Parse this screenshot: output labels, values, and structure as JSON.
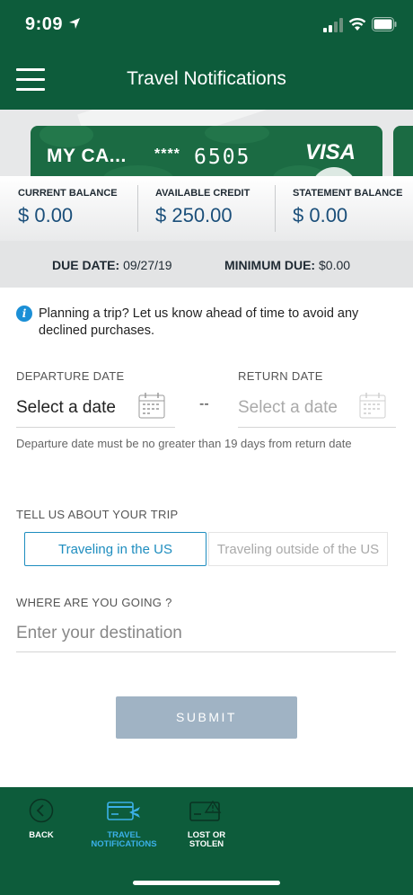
{
  "status_bar": {
    "time": "9:09"
  },
  "nav": {
    "title": "Travel Notifications",
    "menu_icon": "hamburger-menu-icon"
  },
  "card": {
    "name": "MY CA...",
    "masked": "****",
    "last_digits": "6505",
    "network": "VISA",
    "color": "#1b6b43"
  },
  "balances": [
    {
      "label": "CURRENT BALANCE",
      "value": "$ 0.00"
    },
    {
      "label": "AVAILABLE CREDIT",
      "value": "$ 250.00"
    },
    {
      "label": "STATEMENT BALANCE",
      "value": "$ 0.00"
    }
  ],
  "due": {
    "due_label": "DUE DATE:",
    "due_value": "09/27/19",
    "min_label": "MINIMUM DUE:",
    "min_value": "$0.00"
  },
  "info": {
    "text": "Planning a trip? Let us know ahead of time to avoid any declined purchases."
  },
  "dates": {
    "departure_label": "DEPARTURE DATE",
    "departure_value": "Select a date",
    "return_label": "RETURN DATE",
    "return_value": "Select a date",
    "separator": "--",
    "hint": "Departure date must be no greater than 19 days from return date"
  },
  "trip": {
    "label": "TELL US ABOUT YOUR TRIP",
    "options": [
      "Traveling in the US",
      "Traveling outside of the US"
    ],
    "selected": "Traveling in the US"
  },
  "destination": {
    "label": "WHERE ARE YOU GOING ?",
    "placeholder": "Enter your destination",
    "value": ""
  },
  "submit": {
    "label": "SUBMIT"
  },
  "bottom_nav": [
    {
      "label": "BACK",
      "icon": "back-circle-icon",
      "active": false
    },
    {
      "label": "TRAVEL NOTIFICATIONS",
      "icon": "card-plane-icon",
      "active": true
    },
    {
      "label": "LOST OR STOLEN",
      "icon": "card-alert-icon",
      "active": false
    }
  ],
  "colors": {
    "brand_green": "#0d5c3b",
    "accent_blue": "#1e8dbf",
    "submit_disabled": "#a0b3c4",
    "active_tab": "#3bb0e8"
  }
}
